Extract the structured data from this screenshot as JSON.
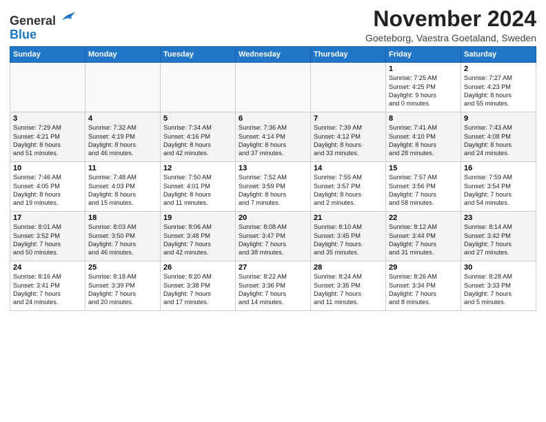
{
  "header": {
    "logo_general": "General",
    "logo_blue": "Blue",
    "month_title": "November 2024",
    "location": "Goeteborg, Vaestra Goetaland, Sweden"
  },
  "weekdays": [
    "Sunday",
    "Monday",
    "Tuesday",
    "Wednesday",
    "Thursday",
    "Friday",
    "Saturday"
  ],
  "weeks": [
    [
      {
        "day": "",
        "info": ""
      },
      {
        "day": "",
        "info": ""
      },
      {
        "day": "",
        "info": ""
      },
      {
        "day": "",
        "info": ""
      },
      {
        "day": "",
        "info": ""
      },
      {
        "day": "1",
        "info": "Sunrise: 7:25 AM\nSunset: 4:25 PM\nDaylight: 9 hours\nand 0 minutes."
      },
      {
        "day": "2",
        "info": "Sunrise: 7:27 AM\nSunset: 4:23 PM\nDaylight: 8 hours\nand 55 minutes."
      }
    ],
    [
      {
        "day": "3",
        "info": "Sunrise: 7:29 AM\nSunset: 4:21 PM\nDaylight: 8 hours\nand 51 minutes."
      },
      {
        "day": "4",
        "info": "Sunrise: 7:32 AM\nSunset: 4:19 PM\nDaylight: 8 hours\nand 46 minutes."
      },
      {
        "day": "5",
        "info": "Sunrise: 7:34 AM\nSunset: 4:16 PM\nDaylight: 8 hours\nand 42 minutes."
      },
      {
        "day": "6",
        "info": "Sunrise: 7:36 AM\nSunset: 4:14 PM\nDaylight: 8 hours\nand 37 minutes."
      },
      {
        "day": "7",
        "info": "Sunrise: 7:39 AM\nSunset: 4:12 PM\nDaylight: 8 hours\nand 33 minutes."
      },
      {
        "day": "8",
        "info": "Sunrise: 7:41 AM\nSunset: 4:10 PM\nDaylight: 8 hours\nand 28 minutes."
      },
      {
        "day": "9",
        "info": "Sunrise: 7:43 AM\nSunset: 4:08 PM\nDaylight: 8 hours\nand 24 minutes."
      }
    ],
    [
      {
        "day": "10",
        "info": "Sunrise: 7:46 AM\nSunset: 4:05 PM\nDaylight: 8 hours\nand 19 minutes."
      },
      {
        "day": "11",
        "info": "Sunrise: 7:48 AM\nSunset: 4:03 PM\nDaylight: 8 hours\nand 15 minutes."
      },
      {
        "day": "12",
        "info": "Sunrise: 7:50 AM\nSunset: 4:01 PM\nDaylight: 8 hours\nand 11 minutes."
      },
      {
        "day": "13",
        "info": "Sunrise: 7:52 AM\nSunset: 3:59 PM\nDaylight: 8 hours\nand 7 minutes."
      },
      {
        "day": "14",
        "info": "Sunrise: 7:55 AM\nSunset: 3:57 PM\nDaylight: 8 hours\nand 2 minutes."
      },
      {
        "day": "15",
        "info": "Sunrise: 7:57 AM\nSunset: 3:56 PM\nDaylight: 7 hours\nand 58 minutes."
      },
      {
        "day": "16",
        "info": "Sunrise: 7:59 AM\nSunset: 3:54 PM\nDaylight: 7 hours\nand 54 minutes."
      }
    ],
    [
      {
        "day": "17",
        "info": "Sunrise: 8:01 AM\nSunset: 3:52 PM\nDaylight: 7 hours\nand 50 minutes."
      },
      {
        "day": "18",
        "info": "Sunrise: 8:03 AM\nSunset: 3:50 PM\nDaylight: 7 hours\nand 46 minutes."
      },
      {
        "day": "19",
        "info": "Sunrise: 8:06 AM\nSunset: 3:48 PM\nDaylight: 7 hours\nand 42 minutes."
      },
      {
        "day": "20",
        "info": "Sunrise: 8:08 AM\nSunset: 3:47 PM\nDaylight: 7 hours\nand 38 minutes."
      },
      {
        "day": "21",
        "info": "Sunrise: 8:10 AM\nSunset: 3:45 PM\nDaylight: 7 hours\nand 35 minutes."
      },
      {
        "day": "22",
        "info": "Sunrise: 8:12 AM\nSunset: 3:44 PM\nDaylight: 7 hours\nand 31 minutes."
      },
      {
        "day": "23",
        "info": "Sunrise: 8:14 AM\nSunset: 3:42 PM\nDaylight: 7 hours\nand 27 minutes."
      }
    ],
    [
      {
        "day": "24",
        "info": "Sunrise: 8:16 AM\nSunset: 3:41 PM\nDaylight: 7 hours\nand 24 minutes."
      },
      {
        "day": "25",
        "info": "Sunrise: 8:18 AM\nSunset: 3:39 PM\nDaylight: 7 hours\nand 20 minutes."
      },
      {
        "day": "26",
        "info": "Sunrise: 8:20 AM\nSunset: 3:38 PM\nDaylight: 7 hours\nand 17 minutes."
      },
      {
        "day": "27",
        "info": "Sunrise: 8:22 AM\nSunset: 3:36 PM\nDaylight: 7 hours\nand 14 minutes."
      },
      {
        "day": "28",
        "info": "Sunrise: 8:24 AM\nSunset: 3:35 PM\nDaylight: 7 hours\nand 11 minutes."
      },
      {
        "day": "29",
        "info": "Sunrise: 8:26 AM\nSunset: 3:34 PM\nDaylight: 7 hours\nand 8 minutes."
      },
      {
        "day": "30",
        "info": "Sunrise: 8:28 AM\nSunset: 3:33 PM\nDaylight: 7 hours\nand 5 minutes."
      }
    ]
  ]
}
